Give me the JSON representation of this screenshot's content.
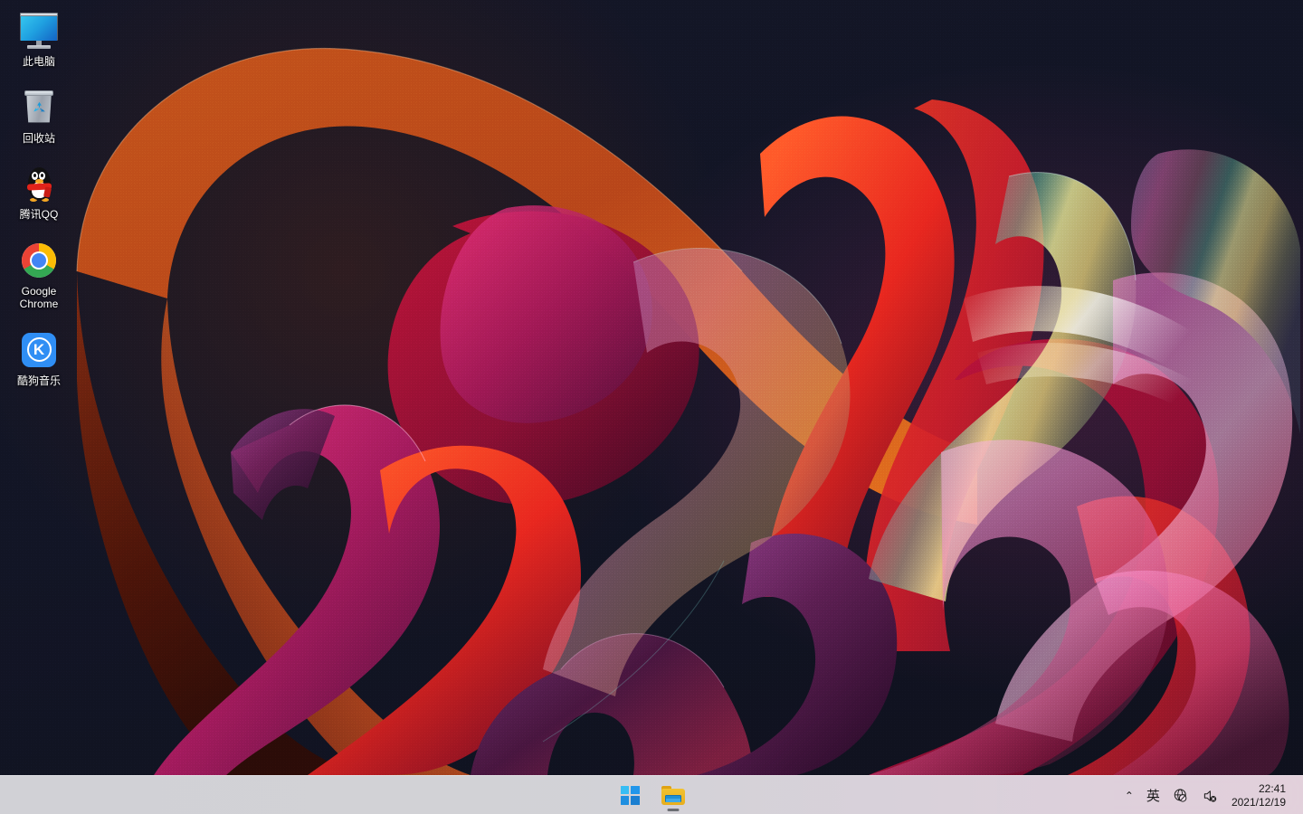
{
  "desktop": {
    "icons": [
      {
        "id": "this-pc",
        "label": "此电脑",
        "icon": "monitor-icon"
      },
      {
        "id": "recycle-bin",
        "label": "回收站",
        "icon": "recycle-bin-icon"
      },
      {
        "id": "tencent-qq",
        "label": "腾讯QQ",
        "icon": "qq-penguin-icon"
      },
      {
        "id": "google-chrome",
        "label": "Google Chrome",
        "icon": "chrome-icon"
      },
      {
        "id": "kugou-music",
        "label": "酷狗音乐",
        "icon": "kugou-icon"
      }
    ],
    "wallpaper_name": "Windows 11 Flow abstract ribbons"
  },
  "taskbar": {
    "start_button": {
      "label": "开始",
      "icon": "windows-logo-icon"
    },
    "pinned": [
      {
        "id": "file-explorer",
        "label": "文件资源管理器",
        "icon": "folder-icon",
        "running": true
      }
    ],
    "tray": [
      {
        "id": "show-hidden-icons",
        "label": "显示隐藏的图标",
        "icon": "chevron-up-icon",
        "glyph": "⌃"
      },
      {
        "id": "ime-indicator",
        "label": "英",
        "icon": "ime-icon",
        "glyph": "英"
      },
      {
        "id": "network",
        "label": "网络 - 无 Internet 连接",
        "icon": "globe-disconnected-icon"
      },
      {
        "id": "volume",
        "label": "音量 - 已静音",
        "icon": "speaker-muted-icon"
      }
    ],
    "clock": {
      "time": "22:41",
      "date": "2021/12/19"
    }
  },
  "colors": {
    "accent": "#1e8ad6",
    "taskbar_left": "#dddde2",
    "taskbar_right": "#eedbe6",
    "wallpaper_bg": "#141626",
    "icon_label": "#ffffff"
  }
}
